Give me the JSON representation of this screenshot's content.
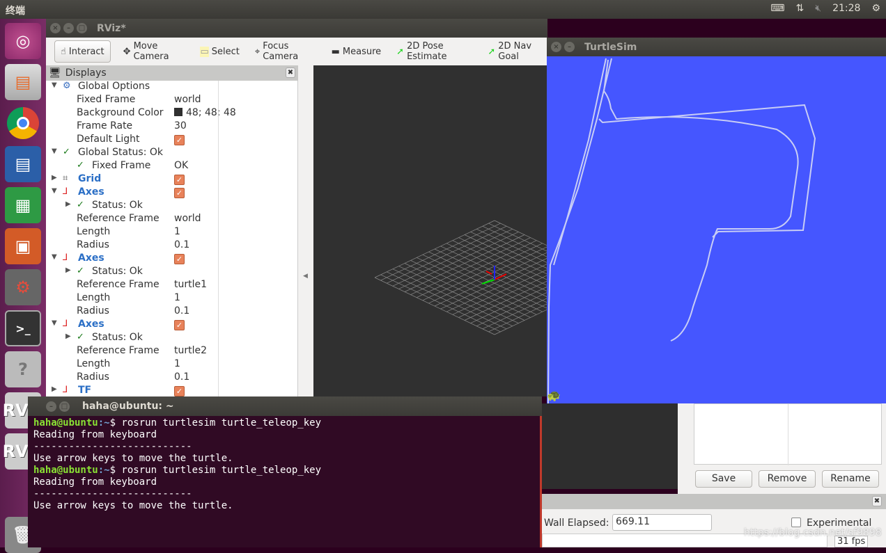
{
  "topbar": {
    "title": "终端",
    "time": "21:28",
    "icons": [
      "keyboard-icon",
      "network-icon",
      "volume-muted-icon",
      "power-gear-icon"
    ]
  },
  "launcher": {
    "items": [
      "ubuntu-dash",
      "files",
      "chrome",
      "writer",
      "calc",
      "impress",
      "system-settings",
      "terminal",
      "help",
      "rviz",
      "rviz",
      "trash"
    ]
  },
  "rviz": {
    "title": "RViz*",
    "toolbar": [
      {
        "label": "Interact",
        "icon": "hand-icon"
      },
      {
        "label": "Move Camera",
        "icon": "move-camera-icon"
      },
      {
        "label": "Select",
        "icon": "select-icon"
      },
      {
        "label": "Focus Camera",
        "icon": "focus-camera-icon"
      },
      {
        "label": "Measure",
        "icon": "ruler-icon"
      },
      {
        "label": "2D Pose Estimate",
        "icon": "green-arrow-icon"
      },
      {
        "label": "2D Nav Goal",
        "icon": "green-arrow-icon"
      }
    ],
    "displays": {
      "title": "Displays",
      "rows": [
        {
          "level": 0,
          "exp": "down",
          "icon": "gear",
          "label": "Global Options",
          "value": "",
          "type": "text"
        },
        {
          "level": 1,
          "exp": "",
          "icon": "",
          "label": "Fixed Frame",
          "value": "world",
          "type": "text"
        },
        {
          "level": 1,
          "exp": "",
          "icon": "",
          "label": "Background Color",
          "value": "48; 48; 48",
          "type": "color"
        },
        {
          "level": 1,
          "exp": "",
          "icon": "",
          "label": "Frame Rate",
          "value": "30",
          "type": "text"
        },
        {
          "level": 1,
          "exp": "",
          "icon": "",
          "label": "Default Light",
          "value": "true",
          "type": "checkbox"
        },
        {
          "level": 0,
          "exp": "down",
          "icon": "check",
          "label": "Global Status: Ok",
          "value": "",
          "type": "text"
        },
        {
          "level": 2,
          "exp": "",
          "icon": "check",
          "label": "Fixed Frame",
          "value": "OK",
          "type": "text"
        },
        {
          "level": 0,
          "exp": "right",
          "icon": "grid",
          "label": "Grid",
          "value": "true",
          "type": "checkbox",
          "blue": true
        },
        {
          "level": 0,
          "exp": "down",
          "icon": "axes",
          "label": "Axes",
          "value": "true",
          "type": "checkbox",
          "blue": true
        },
        {
          "level": 2,
          "exp": "right",
          "icon": "check",
          "label": "Status: Ok",
          "value": "",
          "type": "text"
        },
        {
          "level": 1,
          "exp": "",
          "icon": "",
          "label": "Reference Frame",
          "value": "world",
          "type": "text"
        },
        {
          "level": 1,
          "exp": "",
          "icon": "",
          "label": "Length",
          "value": "1",
          "type": "text"
        },
        {
          "level": 1,
          "exp": "",
          "icon": "",
          "label": "Radius",
          "value": "0.1",
          "type": "text"
        },
        {
          "level": 0,
          "exp": "down",
          "icon": "axes",
          "label": "Axes",
          "value": "true",
          "type": "checkbox",
          "blue": true
        },
        {
          "level": 2,
          "exp": "right",
          "icon": "check",
          "label": "Status: Ok",
          "value": "",
          "type": "text"
        },
        {
          "level": 1,
          "exp": "",
          "icon": "",
          "label": "Reference Frame",
          "value": "turtle1",
          "type": "text"
        },
        {
          "level": 1,
          "exp": "",
          "icon": "",
          "label": "Length",
          "value": "1",
          "type": "text"
        },
        {
          "level": 1,
          "exp": "",
          "icon": "",
          "label": "Radius",
          "value": "0.1",
          "type": "text"
        },
        {
          "level": 0,
          "exp": "down",
          "icon": "axes",
          "label": "Axes",
          "value": "true",
          "type": "checkbox",
          "blue": true
        },
        {
          "level": 2,
          "exp": "right",
          "icon": "check",
          "label": "Status: Ok",
          "value": "",
          "type": "text"
        },
        {
          "level": 1,
          "exp": "",
          "icon": "",
          "label": "Reference Frame",
          "value": "turtle2",
          "type": "text"
        },
        {
          "level": 1,
          "exp": "",
          "icon": "",
          "label": "Length",
          "value": "1",
          "type": "text"
        },
        {
          "level": 1,
          "exp": "",
          "icon": "",
          "label": "Radius",
          "value": "0.1",
          "type": "text"
        },
        {
          "level": 0,
          "exp": "right",
          "icon": "tf",
          "label": "TF",
          "value": "true",
          "type": "checkbox",
          "blue": true
        }
      ]
    },
    "views": {
      "save": "Save",
      "remove": "Remove",
      "rename": "Rename"
    },
    "time": {
      "wall_elapsed_label": "Wall Elapsed:",
      "wall_elapsed": "669.11",
      "experimental": "Experimental",
      "experimental_checked": false,
      "fps": "31 fps"
    }
  },
  "turtlesim": {
    "title": "TurtleSim",
    "background": "#4556ff"
  },
  "terminal": {
    "title": "haha@ubuntu: ~",
    "lines": [
      {
        "user": "haha@ubuntu",
        "path": ":~",
        "cmd": "$ rosrun turtlesim turtle_teleop_key"
      },
      {
        "text": "Reading from keyboard"
      },
      {
        "text": "---------------------------"
      },
      {
        "text": "Use arrow keys to move the turtle."
      },
      {
        "user": "haha@ubuntu",
        "path": ":~",
        "cmd": "$ rosrun turtlesim turtle_teleop_key"
      },
      {
        "text": "Reading from keyboard"
      },
      {
        "text": "---------------------------"
      },
      {
        "text": "Use arrow keys to move the turtle."
      }
    ]
  },
  "watermark": "https://blog.csdn.net/sf9898"
}
